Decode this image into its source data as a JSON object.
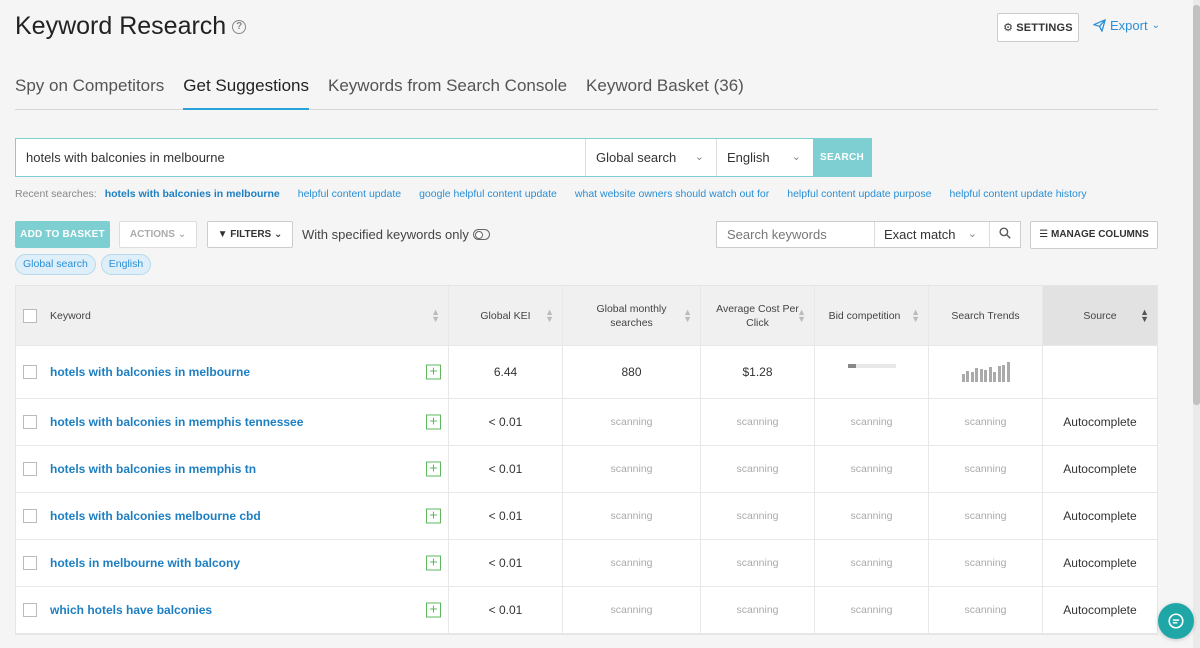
{
  "header": {
    "title": "Keyword Research",
    "settings_label": "SETTINGS",
    "export_label": "Export"
  },
  "tabs": [
    {
      "label": "Spy on Competitors",
      "active": false
    },
    {
      "label": "Get Suggestions",
      "active": true
    },
    {
      "label": "Keywords from Search Console",
      "active": false
    },
    {
      "label": "Keyword Basket (36)",
      "active": false
    }
  ],
  "search": {
    "value": "hotels with balconies in melbourne",
    "scope": "Global search",
    "language": "English",
    "button_label": "SEARCH"
  },
  "recent": {
    "label": "Recent searches:",
    "items": [
      "hotels with balconies in melbourne",
      "helpful content update",
      "google helpful content update",
      "what website owners should watch out for",
      "helpful content update purpose",
      "helpful content update history"
    ]
  },
  "toolbar": {
    "add_to_basket": "ADD TO BASKET",
    "actions": "ACTIONS",
    "filters": "FILTERS",
    "specified_only": "With specified keywords only",
    "keyword_search_placeholder": "Search keywords",
    "match_type": "Exact match",
    "manage_columns": "MANAGE COLUMNS"
  },
  "chips": [
    "Global search",
    "English"
  ],
  "table": {
    "columns": {
      "keyword": "Keyword",
      "kei": "Global KEI",
      "gms": "Global monthly searches",
      "cpc": "Average Cost Per Click",
      "bid": "Bid competition",
      "trends": "Search Trends",
      "source": "Source"
    },
    "scanning_text": "scanning",
    "rows": [
      {
        "keyword": "hotels with balconies in melbourne",
        "kei": "6.44",
        "gms": "880",
        "cpc": "$1.28",
        "bid_level": 0.18,
        "trends": [
          0.4,
          0.55,
          0.5,
          0.7,
          0.65,
          0.6,
          0.75,
          0.5,
          0.8,
          0.85,
          1.0
        ],
        "source": ""
      },
      {
        "keyword": "hotels with balconies in memphis tennessee",
        "kei": "< 0.01",
        "source": "Autocomplete"
      },
      {
        "keyword": "hotels with balconies in memphis tn",
        "kei": "< 0.01",
        "source": "Autocomplete"
      },
      {
        "keyword": "hotels with balconies melbourne cbd",
        "kei": "< 0.01",
        "source": "Autocomplete"
      },
      {
        "keyword": "hotels in melbourne with balcony",
        "kei": "< 0.01",
        "source": "Autocomplete"
      },
      {
        "keyword": "which hotels have balconies",
        "kei": "< 0.01",
        "source": "Autocomplete"
      }
    ]
  },
  "colors": {
    "accent": "#7ecfd2",
    "link": "#2a8fd6",
    "tab_underline": "#29a3d9",
    "add_icon": "#5cb85c",
    "chat": "#1fa7a8"
  }
}
